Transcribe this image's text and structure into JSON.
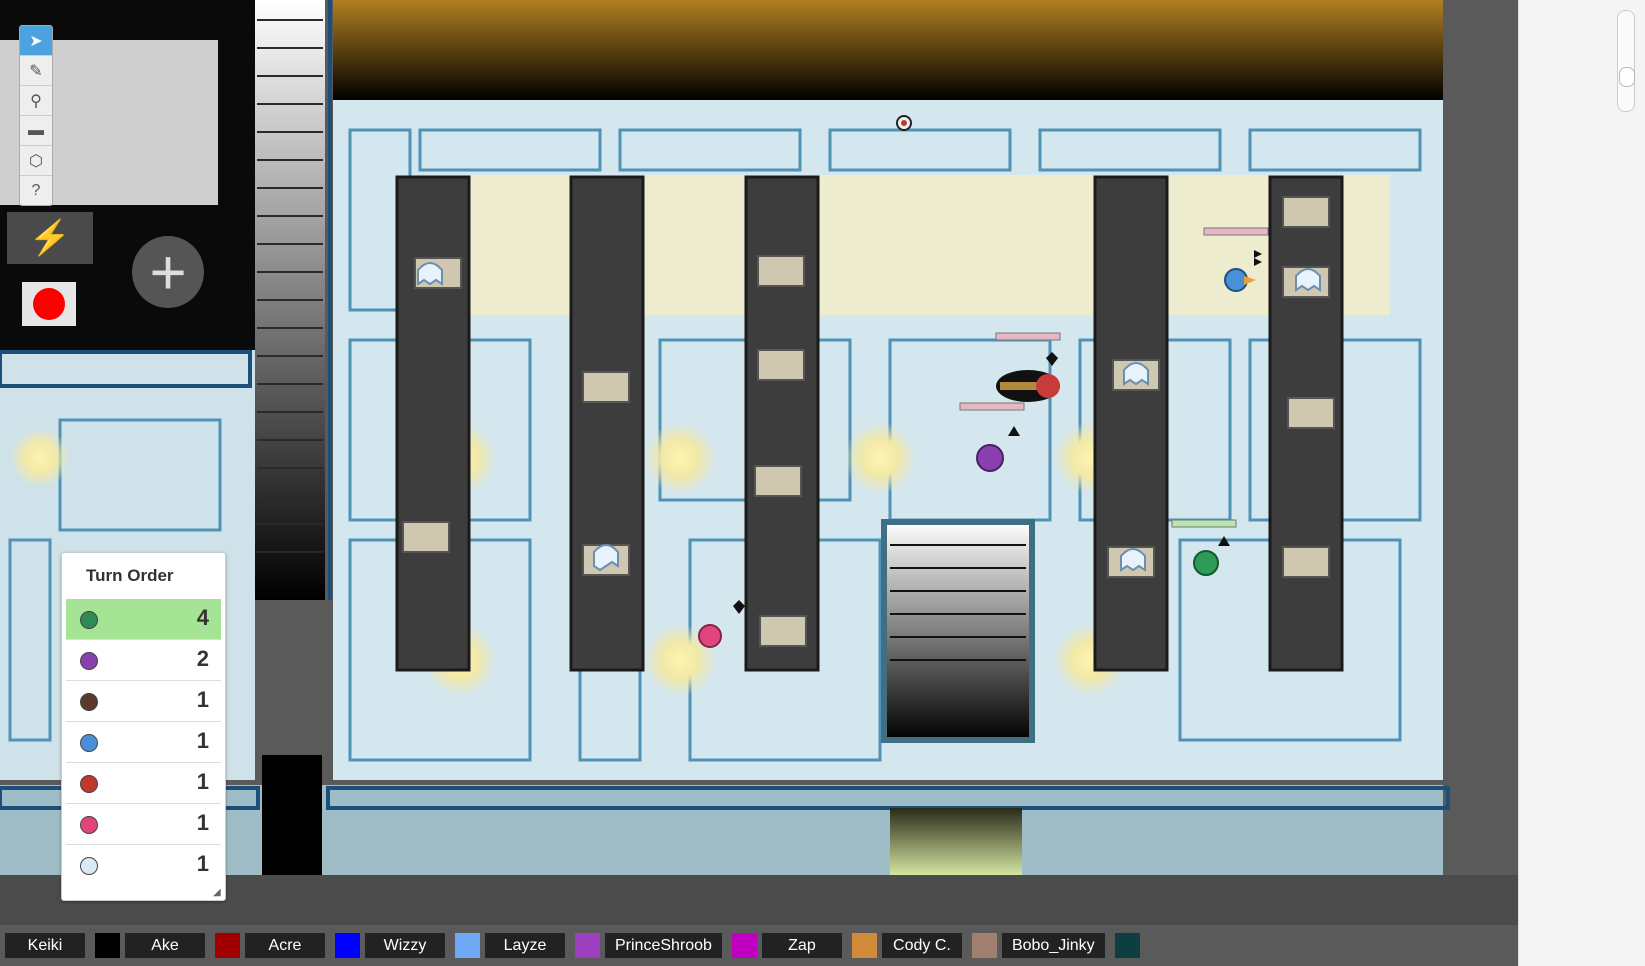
{
  "toolbar": {
    "tools": [
      {
        "name": "select-tool",
        "icon": "cursor-icon",
        "glyph": "➤",
        "active": true
      },
      {
        "name": "draw-tool",
        "icon": "brush-icon",
        "glyph": "✎",
        "active": false
      },
      {
        "name": "zoom-tool",
        "icon": "magnifier-icon",
        "glyph": "⚲",
        "active": false
      },
      {
        "name": "measure-tool",
        "icon": "ruler-icon",
        "glyph": "▬",
        "active": false
      },
      {
        "name": "dice-tool",
        "icon": "d20-icon",
        "glyph": "⬡",
        "active": false
      },
      {
        "name": "help-tool",
        "icon": "help-icon",
        "glyph": "?",
        "active": false
      }
    ],
    "fx_icon": "lightning-icon",
    "fx_glyph": "⚡",
    "record_icon": "record-icon",
    "add_glyph": "+"
  },
  "turn_order": {
    "title": "Turn Order",
    "entries": [
      {
        "token": "green-creature",
        "color": "#2e8b57",
        "value": "4",
        "current": true
      },
      {
        "token": "purple-creature",
        "color": "#8a3fae",
        "value": "2",
        "current": false
      },
      {
        "token": "dark-hooded-figure",
        "color": "#5a3a2a",
        "value": "1",
        "current": false
      },
      {
        "token": "blue-fox",
        "color": "#4a90d9",
        "value": "1",
        "current": false
      },
      {
        "token": "red-bird",
        "color": "#c0392b",
        "value": "1",
        "current": false
      },
      {
        "token": "pink-creature",
        "color": "#e0457b",
        "value": "1",
        "current": false
      },
      {
        "token": "white-ghost",
        "color": "#d9e9f5",
        "value": "1",
        "current": false
      }
    ]
  },
  "players": [
    {
      "name": "Keiki",
      "color": "#000000"
    },
    {
      "name": "Ake",
      "color": "#a00000"
    },
    {
      "name": "Acre",
      "color": "#0000ff"
    },
    {
      "name": "Wizzy",
      "color": "#6fa8f5"
    },
    {
      "name": "Layze",
      "color": "#9c3fbf"
    },
    {
      "name": "PrinceShroob",
      "color": "#c000c0"
    },
    {
      "name": "Zap",
      "color": "#d08a38"
    },
    {
      "name": "Cody C.",
      "color": "#a07f6e"
    },
    {
      "name": "Bobo_Jinky",
      "color": "#0e3e42"
    }
  ]
}
